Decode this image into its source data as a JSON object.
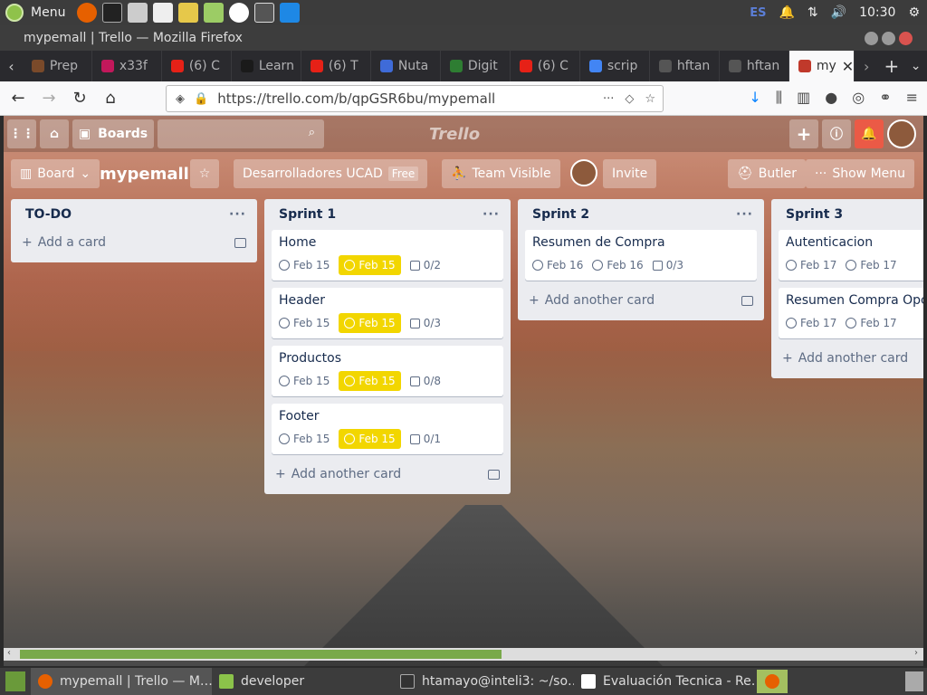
{
  "system": {
    "menu_label": "Menu",
    "lang": "ES",
    "clock": "10:30"
  },
  "window": {
    "title": "mypemall | Trello — Mozilla Firefox"
  },
  "tabs": [
    {
      "label": "Prep",
      "color": "#7a4a2a"
    },
    {
      "label": "x33f",
      "color": "#c2185b"
    },
    {
      "label": "(6) C",
      "color": "#e62117"
    },
    {
      "label": "Learn",
      "color": "#1a1a1a"
    },
    {
      "label": "(6) T",
      "color": "#e62117"
    },
    {
      "label": "Nuta",
      "color": "#3f6bd8"
    },
    {
      "label": "Digit",
      "color": "#2e7d32"
    },
    {
      "label": "(6) C",
      "color": "#e62117"
    },
    {
      "label": "scrip",
      "color": "#4285f4"
    },
    {
      "label": "hftan",
      "color": "#555555"
    },
    {
      "label": "hftan",
      "color": "#555555"
    },
    {
      "label": "my",
      "color": "#c0392b"
    }
  ],
  "navbar": {
    "url": "https://trello.com/b/qpGSR6bu/mypemall"
  },
  "trello": {
    "boards_label": "Boards",
    "logo": "Trello",
    "board_menu": "Board",
    "board_name": "mypemall",
    "team": "Desarrolladores UCAD",
    "free": "Free",
    "visibility": "Team Visible",
    "invite": "Invite",
    "butler": "Butler",
    "show_menu": "Show Menu"
  },
  "lists": [
    {
      "title": "TO-DO",
      "cards": [],
      "add_label": "Add a card"
    },
    {
      "title": "Sprint 1",
      "add_label": "Add another card",
      "cards": [
        {
          "title": "Home",
          "start": "Feb 15",
          "due": "Feb 15",
          "check": "0/2"
        },
        {
          "title": "Header",
          "start": "Feb 15",
          "due": "Feb 15",
          "check": "0/3"
        },
        {
          "title": "Productos",
          "start": "Feb 15",
          "due": "Feb 15",
          "check": "0/8"
        },
        {
          "title": "Footer",
          "start": "Feb 15",
          "due": "Feb 15",
          "check": "0/1"
        }
      ]
    },
    {
      "title": "Sprint 2",
      "add_label": "Add another card",
      "cards": [
        {
          "title": "Resumen de Compra",
          "start": "Feb 16",
          "due": "Feb 16",
          "check": "0/3"
        }
      ]
    },
    {
      "title": "Sprint 3",
      "add_label": "Add another card",
      "cards": [
        {
          "title": "Autenticacion",
          "start": "Feb 17",
          "due": "Feb 17",
          "check": ""
        },
        {
          "title": "Resumen Compra Opcio",
          "start": "Feb 17",
          "due": "Feb 17",
          "check": ""
        }
      ]
    }
  ],
  "taskbar": [
    {
      "label": "mypemall | Trello — M…",
      "color": "#e66000"
    },
    {
      "label": "developer",
      "color": "#8bc34a"
    },
    {
      "label": "htamayo@inteli3: ~/so…",
      "color": "#333333"
    },
    {
      "label": "Evaluación Tecnica - Re…",
      "color": "#ffffff"
    }
  ]
}
